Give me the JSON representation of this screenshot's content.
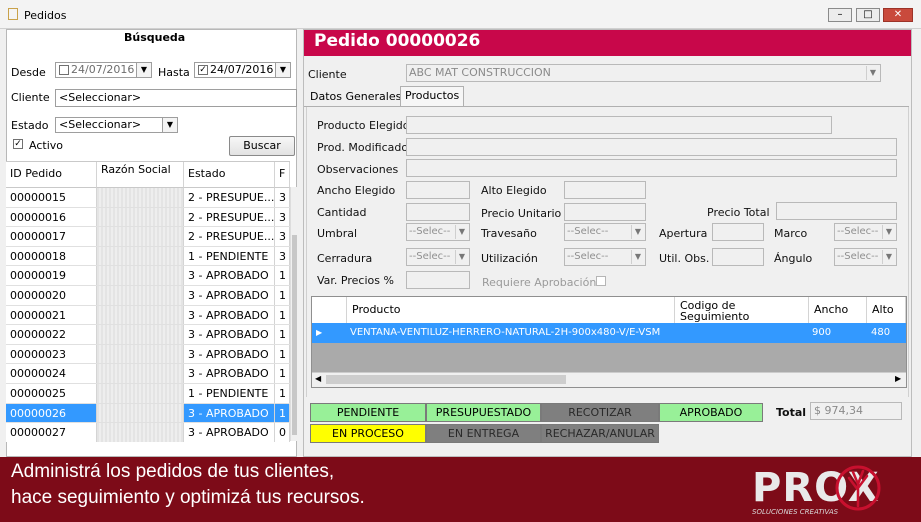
{
  "window": {
    "title": "Pedidos"
  },
  "search": {
    "title": "Búsqueda",
    "desde_label": "Desde",
    "desde_value": "24/07/2016",
    "hasta_label": "Hasta",
    "hasta_value": "24/07/2016",
    "cliente_label": "Cliente",
    "cliente_value": "<Seleccionar>",
    "estado_label": "Estado",
    "estado_value": "<Seleccionar>",
    "activo_label": "Activo",
    "buscar_label": "Buscar"
  },
  "orders_grid": {
    "headers": [
      "ID Pedido",
      "Razón Social",
      "Estado",
      "F"
    ],
    "rows": [
      {
        "id": "00000015",
        "estado": "2 - PRESUPUE...",
        "f": "3"
      },
      {
        "id": "00000016",
        "estado": "2 - PRESUPUE...",
        "f": "3"
      },
      {
        "id": "00000017",
        "estado": "2 - PRESUPUE...",
        "f": "3"
      },
      {
        "id": "00000018",
        "estado": "1 - PENDIENTE",
        "f": "3"
      },
      {
        "id": "00000019",
        "estado": "3 - APROBADO",
        "f": "1"
      },
      {
        "id": "00000020",
        "estado": "3 - APROBADO",
        "f": "1"
      },
      {
        "id": "00000021",
        "estado": "3 - APROBADO",
        "f": "1"
      },
      {
        "id": "00000022",
        "estado": "3 - APROBADO",
        "f": "1"
      },
      {
        "id": "00000023",
        "estado": "3 - APROBADO",
        "f": "1"
      },
      {
        "id": "00000024",
        "estado": "3 - APROBADO",
        "f": "1"
      },
      {
        "id": "00000025",
        "estado": "1 - PENDIENTE",
        "f": "1"
      },
      {
        "id": "00000026",
        "estado": "3 - APROBADO",
        "f": "1"
      },
      {
        "id": "00000027",
        "estado": "3 - APROBADO",
        "f": "0"
      }
    ],
    "selected_index": 11
  },
  "order": {
    "title": "Pedido 00000026",
    "cliente_label": "Cliente",
    "cliente_value": "ABC MAT CONSTRUCCION",
    "tabs": [
      "Datos Generales",
      "Productos"
    ],
    "active_tab": "Productos"
  },
  "product_form": {
    "producto_elegido": "Producto Elegido",
    "prod_modificado": "Prod. Modificado",
    "observaciones": "Observaciones",
    "ancho_elegido": "Ancho Elegido",
    "alto_elegido": "Alto Elegido",
    "cantidad": "Cantidad",
    "precio_unitario": "Precio Unitario",
    "precio_total": "Precio Total",
    "umbral": "Umbral",
    "travesano": "Travesaño",
    "apertura": "Apertura",
    "marco": "Marco",
    "cerradura": "Cerradura",
    "utilizacion": "Utilización",
    "util_obs": "Util. Obs.",
    "angulo": "Ángulo",
    "var_precios": "Var. Precios %",
    "requiere_aprobacion": "Requiere Aprobación",
    "select_placeholder": "--Selec--"
  },
  "products_grid": {
    "headers": [
      "Producto",
      "Codigo de Seguimiento",
      "Ancho",
      "Alto"
    ],
    "row": {
      "producto": "VENTANA-VENTILUZ-HERRERO-NATURAL-2H-900x480-V/E-VSM",
      "codigo": "",
      "ancho": "900",
      "alto": "480"
    }
  },
  "status_buttons": {
    "pendiente": "PENDIENTE",
    "presupuestado": "PRESUPUESTADO",
    "recotizar": "RECOTIZAR",
    "aprobado": "APROBADO",
    "en_proceso": "EN PROCESO",
    "en_entrega": "EN ENTREGA",
    "rechazar": "RECHAZAR/ANULAR"
  },
  "total": {
    "label": "Total",
    "value": "$ 974,34"
  },
  "banner": {
    "line1": "Administrá los pedidos de tus clientes,",
    "line2": "hace seguimiento y optimizá tus recursos.",
    "brand": "PROX",
    "tagline": "SOLUCIONES CREATIVAS"
  },
  "colors": {
    "header_accent": "#c8074a",
    "banner": "#7d0b18",
    "selection": "#3399ff",
    "pendiente": "#98f098",
    "en_proceso": "#ffff00",
    "gray_state": "#7f7f7f"
  }
}
